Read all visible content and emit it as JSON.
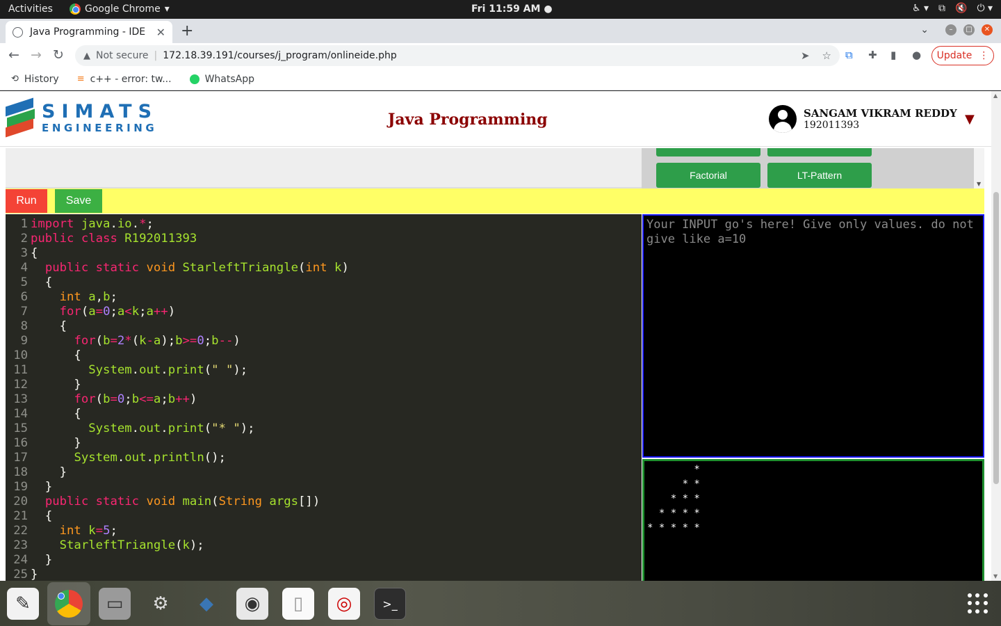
{
  "system": {
    "activities": "Activities",
    "app_name": "Google Chrome",
    "clock": "Fri 11:59 AM"
  },
  "browser": {
    "tab_title": "Java Programming - IDE",
    "not_secure": "Not secure",
    "url": "172.18.39.191/courses/j_program/onlineide.php",
    "update_label": "Update",
    "bookmarks": [
      "History",
      "c++ - error: tw...",
      "WhatsApp"
    ]
  },
  "site": {
    "logo_line1": "SIMATS",
    "logo_line2": "ENGINEERING",
    "title": "Java Programming",
    "user_name": "SANGAM VIKRAM REDDY",
    "user_id": "192011393"
  },
  "samples": {
    "buttons": [
      "Factorial",
      "LT-Pattern"
    ]
  },
  "actions": {
    "run_label": "Run",
    "save_label": "Save"
  },
  "editor": {
    "line_numbers": "1\n2\n3\n4\n5\n6\n7\n8\n9\n10\n11\n12\n13\n14\n15\n16\n17\n18\n19\n20\n21\n22\n23\n24\n25"
  },
  "io": {
    "input_placeholder": "Your INPUT go's here! Give only values. do not give like a=10",
    "output_text": "        *\n      * *\n    * * *\n  * * * *\n* * * * *"
  },
  "colors": {
    "run": "#f44336",
    "save": "#3cb043",
    "actionbar": "#ffff66",
    "title": "#8b0000",
    "editor_bg": "#272822"
  }
}
